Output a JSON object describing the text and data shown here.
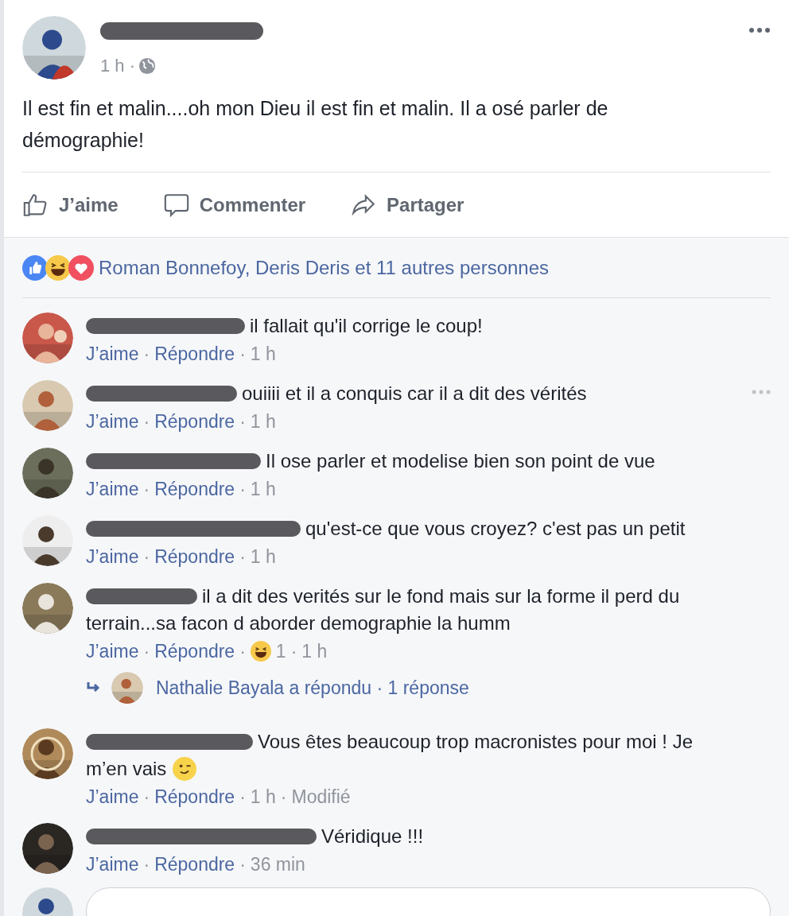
{
  "post": {
    "time": "1 h ·",
    "audience": {
      "kind": "globe"
    },
    "text": "Il est fin et malin....oh mon Dieu il est fin et malin. Il a osé parler de démographie!",
    "actions": [
      {
        "kind": "like",
        "label": "J’aime"
      },
      {
        "kind": "comment",
        "label": "Commenter"
      },
      {
        "kind": "share",
        "label": "Partager"
      }
    ]
  },
  "reactions": {
    "icons": [
      {
        "kind": "like"
      },
      {
        "kind": "haha"
      },
      {
        "kind": "love"
      }
    ],
    "summary": "Roman Bonnefoy, Deris Deris et 11 autres personnes"
  },
  "comments": [
    {
      "lines": [
        "il fallait qu'il corrige le coup!"
      ],
      "meta": [
        {
          "kind": "link",
          "text": "J’aime"
        },
        {
          "kind": "dot",
          "text": "·"
        },
        {
          "kind": "link",
          "text": "Répondre"
        },
        {
          "kind": "dot",
          "text": "·"
        },
        {
          "kind": "time",
          "text": "1 h"
        }
      ]
    },
    {
      "lines": [
        "ouiiii et il a conquis car il a dit des vérités"
      ],
      "menu": true,
      "meta": [
        {
          "kind": "link",
          "text": "J’aime"
        },
        {
          "kind": "dot",
          "text": "·"
        },
        {
          "kind": "link",
          "text": "Répondre"
        },
        {
          "kind": "dot",
          "text": "·"
        },
        {
          "kind": "time",
          "text": "1 h"
        }
      ]
    },
    {
      "lines": [
        "Il ose parler et modelise bien son point de vue"
      ],
      "meta": [
        {
          "kind": "link",
          "text": "J’aime"
        },
        {
          "kind": "dot",
          "text": "·"
        },
        {
          "kind": "link",
          "text": "Répondre"
        },
        {
          "kind": "dot",
          "text": "·"
        },
        {
          "kind": "time",
          "text": "1 h"
        }
      ]
    },
    {
      "lines": [
        "qu'est-ce que vous croyez? c'est pas un petit"
      ],
      "meta": [
        {
          "kind": "link",
          "text": "J’aime"
        },
        {
          "kind": "dot",
          "text": "·"
        },
        {
          "kind": "link",
          "text": "Répondre"
        },
        {
          "kind": "dot",
          "text": "·"
        },
        {
          "kind": "time",
          "text": "1 h"
        }
      ]
    },
    {
      "lines": [
        "il a dit des verités sur le fond mais sur la forme il perd du",
        "terrain...sa facon d aborder demographie la humm"
      ],
      "meta": [
        {
          "kind": "link",
          "text": "J’aime"
        },
        {
          "kind": "dot",
          "text": "·"
        },
        {
          "kind": "link",
          "text": "Répondre"
        },
        {
          "kind": "dot",
          "text": "·"
        },
        {
          "kind": "haha"
        },
        {
          "kind": "time",
          "text": "1"
        },
        {
          "kind": "dot",
          "text": "·"
        },
        {
          "kind": "time",
          "text": "1 h"
        }
      ],
      "replies": {
        "text": "Nathalie Bayala a répondu · 1 réponse"
      }
    },
    {
      "lines": [
        "Vous êtes beaucoup trop macronistes pour moi ! Je",
        "m’en vais"
      ],
      "emoji": {
        "kind": "wink"
      },
      "meta": [
        {
          "kind": "link",
          "text": "J’aime"
        },
        {
          "kind": "dot",
          "text": "·"
        },
        {
          "kind": "link",
          "text": "Répondre"
        },
        {
          "kind": "dot",
          "text": "·"
        },
        {
          "kind": "time",
          "text": "1 h"
        },
        {
          "kind": "dot",
          "text": "·"
        },
        {
          "kind": "time",
          "text": "Modifié"
        }
      ]
    },
    {
      "lines": [
        "Véridique !!!"
      ],
      "meta": [
        {
          "kind": "link",
          "text": "J’aime"
        },
        {
          "kind": "dot",
          "text": "·"
        },
        {
          "kind": "link",
          "text": "Répondre"
        },
        {
          "kind": "dot",
          "text": "·"
        },
        {
          "kind": "time",
          "text": "36 min"
        }
      ]
    }
  ],
  "composer": {
    "kind": "field"
  }
}
